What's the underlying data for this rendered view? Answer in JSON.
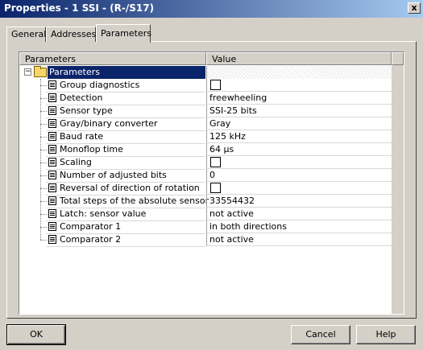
{
  "window": {
    "title": "Properties - 1 SSI - (R-/S17)",
    "close_label": "x"
  },
  "tabs": [
    {
      "label": "General",
      "active": false
    },
    {
      "label": "Addresses",
      "active": false
    },
    {
      "label": "Parameters",
      "active": true
    }
  ],
  "grid": {
    "col_parameters": "Parameters",
    "col_value": "Value",
    "root_label": "Parameters",
    "expander": "−",
    "rows": [
      {
        "name": "Group diagnostics",
        "value": "",
        "checkbox": true
      },
      {
        "name": "Detection",
        "value": "freewheeling",
        "checkbox": false
      },
      {
        "name": "Sensor type",
        "value": "SSI-25 bits",
        "checkbox": false
      },
      {
        "name": "Gray/binary converter",
        "value": "Gray",
        "checkbox": false
      },
      {
        "name": "Baud rate",
        "value": "125 kHz",
        "checkbox": false
      },
      {
        "name": "Monoflop time",
        "value": "64 µs",
        "checkbox": false
      },
      {
        "name": "Scaling",
        "value": "",
        "checkbox": true
      },
      {
        "name": "Number of adjusted bits",
        "value": "0",
        "checkbox": false
      },
      {
        "name": "Reversal of direction of rotation",
        "value": "",
        "checkbox": true
      },
      {
        "name": "Total steps of the absolute sensor",
        "value": "33554432",
        "checkbox": false
      },
      {
        "name": "Latch: sensor value",
        "value": "not active",
        "checkbox": false
      },
      {
        "name": "Comparator 1",
        "value": "in both directions",
        "checkbox": false
      },
      {
        "name": "Comparator 2",
        "value": "not active",
        "checkbox": false
      }
    ]
  },
  "buttons": {
    "ok": "OK",
    "cancel": "Cancel",
    "help": "Help"
  }
}
